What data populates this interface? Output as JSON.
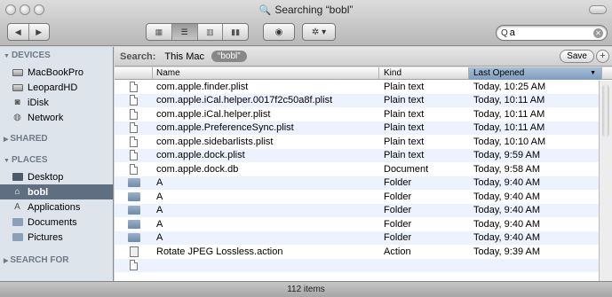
{
  "window": {
    "title": "Searching “bobl”"
  },
  "toolbar": {
    "back_glyph": "◀",
    "forward_glyph": "▶",
    "views": [
      "icon-view",
      "list-view",
      "column-view",
      "cover-flow-view"
    ],
    "quicklook_glyph": "◉",
    "action_glyph": "✲ ▾",
    "search": {
      "value": "a",
      "prefix": "Q"
    }
  },
  "sidebar": {
    "devices_label": "DEVICES",
    "devices": [
      {
        "label": "MacBookPro",
        "icon": "hard-drive-icon"
      },
      {
        "label": "LeopardHD",
        "icon": "hard-drive-icon"
      },
      {
        "label": "iDisk",
        "icon": "idisk-icon"
      },
      {
        "label": "Network",
        "icon": "network-icon"
      }
    ],
    "shared_label": "SHARED",
    "places_label": "PLACES",
    "places": [
      {
        "label": "Desktop",
        "icon": "desktop-icon"
      },
      {
        "label": "bobl",
        "icon": "home-icon"
      },
      {
        "label": "Applications",
        "icon": "applications-icon"
      },
      {
        "label": "Documents",
        "icon": "documents-icon"
      },
      {
        "label": "Pictures",
        "icon": "pictures-icon"
      }
    ],
    "searchfor_label": "SEARCH FOR"
  },
  "scope": {
    "label": "Search:",
    "options": [
      "This Mac",
      "“bobl”"
    ],
    "save_label": "Save",
    "add_label": "+"
  },
  "columns": {
    "name": "Name",
    "kind": "Kind",
    "last_opened": "Last Opened"
  },
  "files": [
    {
      "name": "com.apple.finder.plist",
      "kind": "Plain text",
      "date": "Today, 10:25 AM",
      "icon": "doc"
    },
    {
      "name": "com.apple.iCal.helper.0017f2c50a8f.plist",
      "kind": "Plain text",
      "date": "Today, 10:11 AM",
      "icon": "doc"
    },
    {
      "name": "com.apple.iCal.helper.plist",
      "kind": "Plain text",
      "date": "Today, 10:11 AM",
      "icon": "doc"
    },
    {
      "name": "com.apple.PreferenceSync.plist",
      "kind": "Plain text",
      "date": "Today, 10:11 AM",
      "icon": "doc"
    },
    {
      "name": "com.apple.sidebarlists.plist",
      "kind": "Plain text",
      "date": "Today, 10:10 AM",
      "icon": "doc"
    },
    {
      "name": "com.apple.dock.plist",
      "kind": "Plain text",
      "date": "Today, 9:59 AM",
      "icon": "doc"
    },
    {
      "name": "com.apple.dock.db",
      "kind": "Document",
      "date": "Today, 9:58 AM",
      "icon": "doc"
    },
    {
      "name": "A",
      "kind": "Folder",
      "date": "Today, 9:40 AM",
      "icon": "folder"
    },
    {
      "name": "A",
      "kind": "Folder",
      "date": "Today, 9:40 AM",
      "icon": "folder"
    },
    {
      "name": "A",
      "kind": "Folder",
      "date": "Today, 9:40 AM",
      "icon": "folder"
    },
    {
      "name": "A",
      "kind": "Folder",
      "date": "Today, 9:40 AM",
      "icon": "folder"
    },
    {
      "name": "A",
      "kind": "Folder",
      "date": "Today, 9:40 AM",
      "icon": "folder"
    },
    {
      "name": "Rotate JPEG Lossless.action",
      "kind": "Action",
      "date": "Today, 9:39 AM",
      "icon": "action"
    },
    {
      "name": "",
      "kind": "",
      "date": "",
      "icon": "doc"
    }
  ],
  "status": {
    "items": "112 items"
  }
}
